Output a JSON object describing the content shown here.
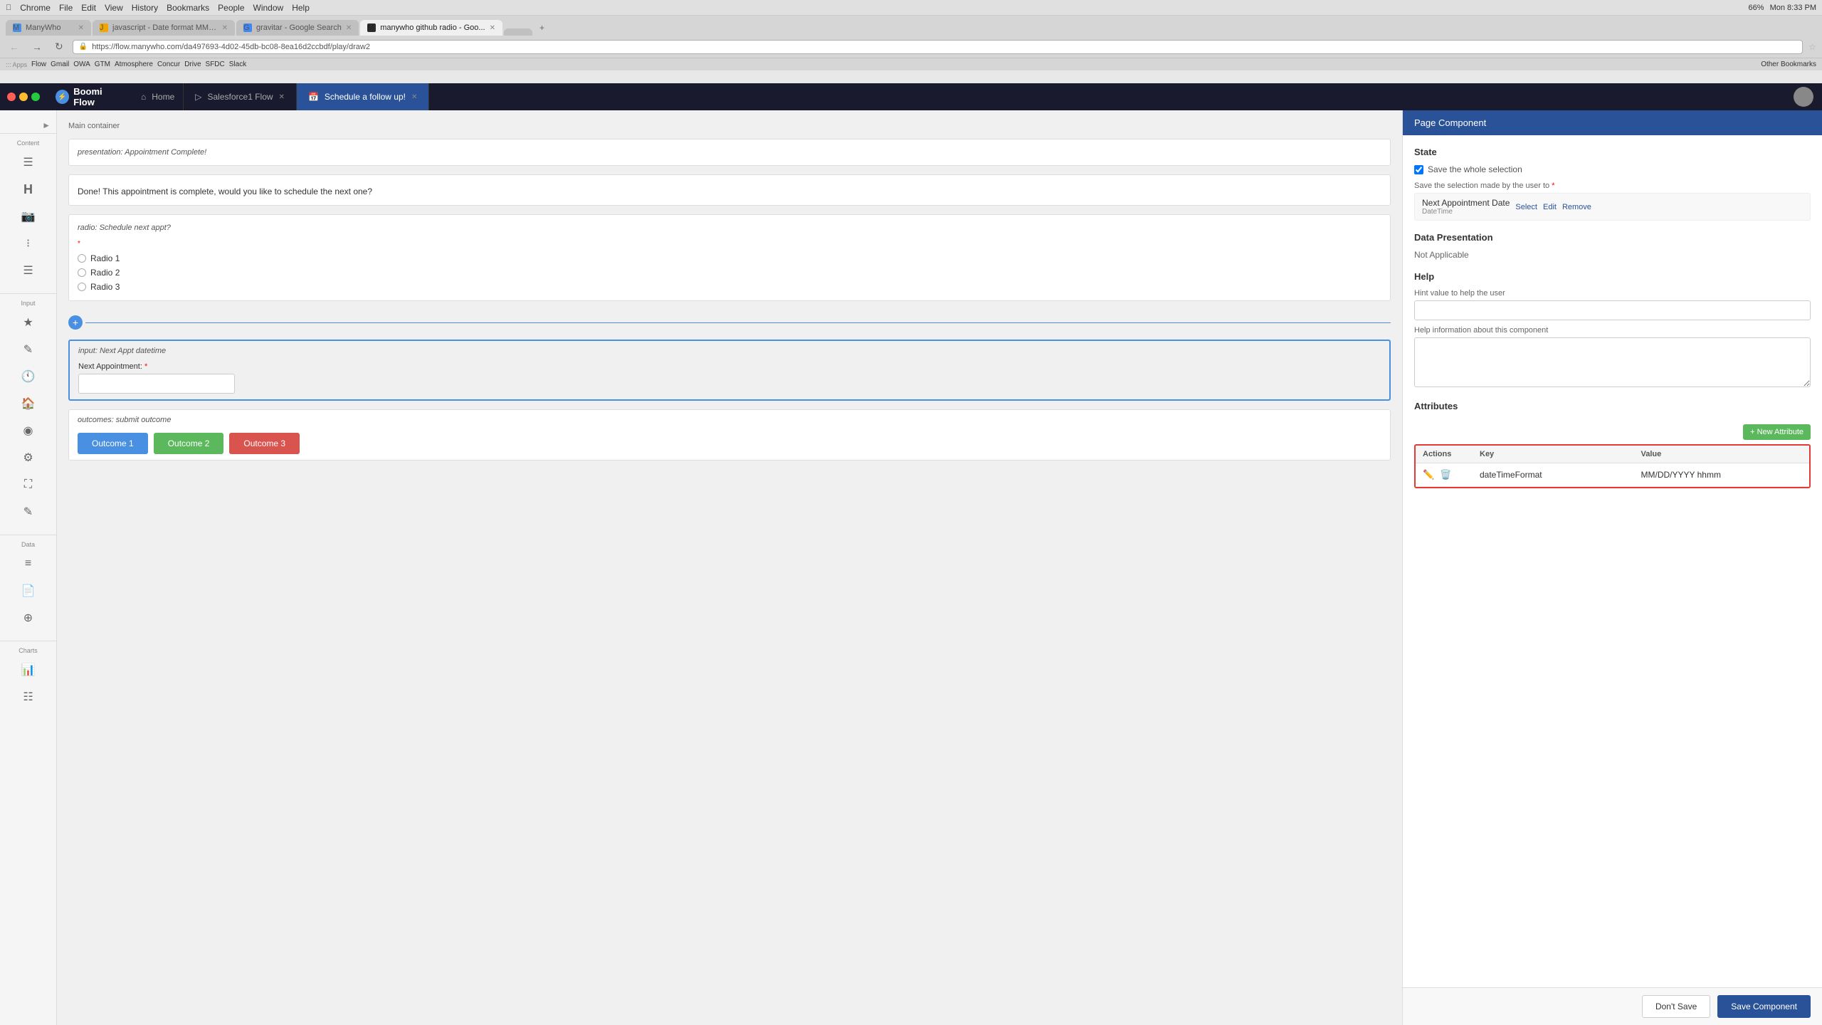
{
  "os": {
    "menuItems": [
      "Chrome",
      "File",
      "Edit",
      "View",
      "History",
      "Bookmarks",
      "People",
      "Window",
      "Help"
    ],
    "time": "Mon 8:33 PM",
    "battery": "66%"
  },
  "browser": {
    "tabs": [
      {
        "id": "manywho",
        "title": "ManyWho",
        "active": false,
        "favicon": "M"
      },
      {
        "id": "dateformat",
        "title": "javascript - Date format MMM...",
        "active": false,
        "favicon": "J"
      },
      {
        "id": "gravitar",
        "title": "gravitar - Google Search",
        "active": false,
        "favicon": "G"
      },
      {
        "id": "manywho-github",
        "title": "manywho github radio - Goo...",
        "active": true,
        "favicon": "M"
      },
      {
        "id": "blank",
        "title": "",
        "active": false,
        "favicon": ""
      }
    ],
    "address": "https://flow.manywho.com/da497693-4d02-45db-bc08-8ea16d2ccbdf/play/draw2",
    "protocol": "Secure",
    "bookmarks": [
      "Apps",
      "Flow",
      "Gmail",
      "OWA",
      "GTM",
      "Atmosphere",
      "Concur",
      "Drive",
      "SFDC",
      "Slack"
    ],
    "otherBookmarks": "Other Bookmarks"
  },
  "appHeader": {
    "logo": "Boomi Flow",
    "tabs": [
      {
        "id": "home",
        "label": "Home",
        "icon": "⌂",
        "active": false,
        "closable": false
      },
      {
        "id": "salesforce",
        "label": "Salesforce1 Flow",
        "active": false,
        "closable": true
      },
      {
        "id": "schedule",
        "label": "Schedule a follow up!",
        "active": true,
        "closable": true
      }
    ]
  },
  "leftPanel": {
    "sections": [
      {
        "id": "content",
        "label": "Content"
      },
      {
        "id": "input",
        "label": "Input"
      },
      {
        "id": "data",
        "label": "Data"
      },
      {
        "id": "charts",
        "label": "Charts"
      }
    ]
  },
  "canvas": {
    "containerLabel": "Main container",
    "sections": [
      {
        "id": "presentation",
        "type": "presentation",
        "label": "presentation: Appointment Complete!",
        "content": "Done!  This appointment is complete, would you like to schedule the next one?"
      },
      {
        "id": "radio",
        "type": "radio",
        "label": "radio: Schedule next appt?",
        "required": true,
        "options": [
          "Radio 1",
          "Radio 2",
          "Radio 3"
        ]
      },
      {
        "id": "input-datetime",
        "type": "input",
        "label": "input: Next Appt datetime",
        "fieldLabel": "Next Appointment:",
        "required": true
      },
      {
        "id": "outcomes",
        "type": "outcomes",
        "label": "outcomes: submit outcome",
        "buttons": [
          {
            "label": "Outcome 1",
            "color": "blue"
          },
          {
            "label": "Outcome 2",
            "color": "green"
          },
          {
            "label": "Outcome 3",
            "color": "red"
          }
        ]
      }
    ]
  },
  "rightPanel": {
    "title": "Page Component",
    "sections": {
      "state": {
        "title": "State",
        "saveWholeSelection": "Save the whole selection",
        "saveSelectionLabel": "Save the selection made by the user to",
        "required": true,
        "valueTitle": "Next Appointment Date",
        "valueSubtitle": "DateTime",
        "actions": [
          "Select",
          "Edit",
          "Remove"
        ]
      },
      "dataPresentation": {
        "title": "Data Presentation",
        "value": "Not Applicable"
      },
      "help": {
        "title": "Help",
        "hintLabel": "Hint value to help the user",
        "infoLabel": "Help information about this component"
      },
      "attributes": {
        "title": "Attributes",
        "newAttributeLabel": "+ New Attribute",
        "tableHeaders": [
          "Actions",
          "Key",
          "Value"
        ],
        "rows": [
          {
            "key": "dateTimeFormat",
            "value": "MM/DD/YYYY hhmm"
          }
        ]
      }
    },
    "footer": {
      "dontSave": "Don't Save",
      "saveComponent": "Save Component"
    }
  }
}
